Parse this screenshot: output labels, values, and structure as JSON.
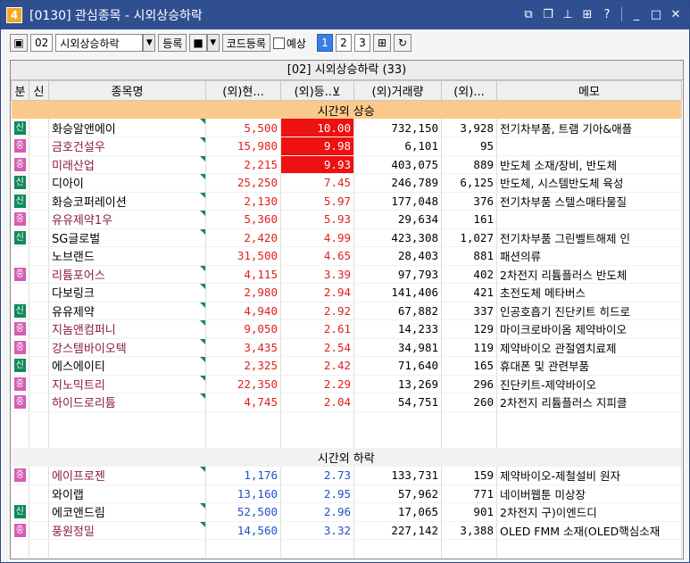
{
  "window": {
    "number": "4",
    "title": "[0130] 관심종목 - 시외상승하락"
  },
  "toolbar": {
    "group_no": "02",
    "group_name": "시외상승하락",
    "register_label": "등록",
    "code_register_label": "코드등록",
    "expect_label": "예상",
    "pages": [
      "1",
      "2",
      "3"
    ]
  },
  "grid": {
    "caption": "[02] 시외상승하락 (33)",
    "headers": [
      "분",
      "신",
      "종목명",
      "(외)현...",
      "(외)등..⊻",
      "(외)거래량",
      "(외)...",
      "메모"
    ],
    "group_up": "시간외 상승",
    "group_down": "시간외 하락",
    "rows_up": [
      {
        "badge": "신",
        "name": "화승알앤에이",
        "price": "5,500",
        "rate": "10.00",
        "volume": "732,150",
        "ext": "3,928",
        "memo": "전기차부품, 트램 기아&애플"
      },
      {
        "badge": "중",
        "name": "금호건설우",
        "price": "15,980",
        "rate": "9.98",
        "volume": "6,101",
        "ext": "95",
        "memo": ""
      },
      {
        "badge": "중",
        "name": "미래산업",
        "price": "2,215",
        "rate": "9.93",
        "volume": "403,075",
        "ext": "889",
        "memo": "반도체 소재/장비, 반도체"
      },
      {
        "badge": "신",
        "name": "디아이",
        "price": "25,250",
        "rate": "7.45",
        "volume": "246,789",
        "ext": "6,125",
        "memo": "반도체, 시스템반도체 육성"
      },
      {
        "badge": "신",
        "name": "화승코퍼레이션",
        "price": "2,130",
        "rate": "5.97",
        "volume": "177,048",
        "ext": "376",
        "memo": "전기차부품 스텔스매타물질"
      },
      {
        "badge": "중",
        "name": "유유제약1우",
        "price": "5,360",
        "rate": "5.93",
        "volume": "29,634",
        "ext": "161",
        "memo": ""
      },
      {
        "badge": "신",
        "name": "SG글로벌",
        "price": "2,420",
        "rate": "4.99",
        "volume": "423,308",
        "ext": "1,027",
        "memo": "전기차부품 그린벨트해제 인"
      },
      {
        "badge": "",
        "name": "노브랜드",
        "price": "31,500",
        "rate": "4.65",
        "volume": "28,403",
        "ext": "881",
        "memo": "패션의류"
      },
      {
        "badge": "중",
        "name": "리튬포어스",
        "price": "4,115",
        "rate": "3.39",
        "volume": "97,793",
        "ext": "402",
        "memo": "2차전지 리튬플러스 반도체"
      },
      {
        "badge": "",
        "name": "다보링크",
        "price": "2,980",
        "rate": "2.94",
        "volume": "141,406",
        "ext": "421",
        "memo": "초전도체 메타버스"
      },
      {
        "badge": "신",
        "name": "유유제약",
        "price": "4,940",
        "rate": "2.92",
        "volume": "67,882",
        "ext": "337",
        "memo": "인공호흡기 진단키트 히드로"
      },
      {
        "badge": "중",
        "name": "지놈앤컴퍼니",
        "price": "9,050",
        "rate": "2.61",
        "volume": "14,233",
        "ext": "129",
        "memo": "마이크로바이옴 제약바이오"
      },
      {
        "badge": "중",
        "name": "강스템바이오텍",
        "price": "3,435",
        "rate": "2.54",
        "volume": "34,981",
        "ext": "119",
        "memo": "제약바이오 관절염치료제"
      },
      {
        "badge": "신",
        "name": "에스에이티",
        "price": "2,325",
        "rate": "2.42",
        "volume": "71,640",
        "ext": "165",
        "memo": "휴대폰 및 관련부품"
      },
      {
        "badge": "중",
        "name": "지노믹트리",
        "price": "22,350",
        "rate": "2.29",
        "volume": "13,269",
        "ext": "296",
        "memo": "진단키트-제약바이오"
      },
      {
        "badge": "중",
        "name": "하이드로리튬",
        "price": "4,745",
        "rate": "2.04",
        "volume": "54,751",
        "ext": "260",
        "memo": "2차전지 리튬플러스 지피클"
      }
    ],
    "rows_down": [
      {
        "badge": "중",
        "name": "에이프로젠",
        "price": "1,176",
        "rate": "2.73",
        "volume": "133,731",
        "ext": "159",
        "memo": "제약바이오-제철설비  원자"
      },
      {
        "badge": "",
        "name": "와이랩",
        "price": "13,160",
        "rate": "2.95",
        "volume": "57,962",
        "ext": "771",
        "memo": "네이버웹툰 미상장"
      },
      {
        "badge": "신",
        "name": "에코앤드림",
        "price": "52,500",
        "rate": "2.96",
        "volume": "17,065",
        "ext": "901",
        "memo": "2차전지 구)이엔드디"
      },
      {
        "badge": "중",
        "name": "풍원정밀",
        "price": "14,560",
        "rate": "3.32",
        "volume": "227,142",
        "ext": "3,388",
        "memo": "OLED FMM 소재(OLED핵심소재"
      }
    ]
  }
}
